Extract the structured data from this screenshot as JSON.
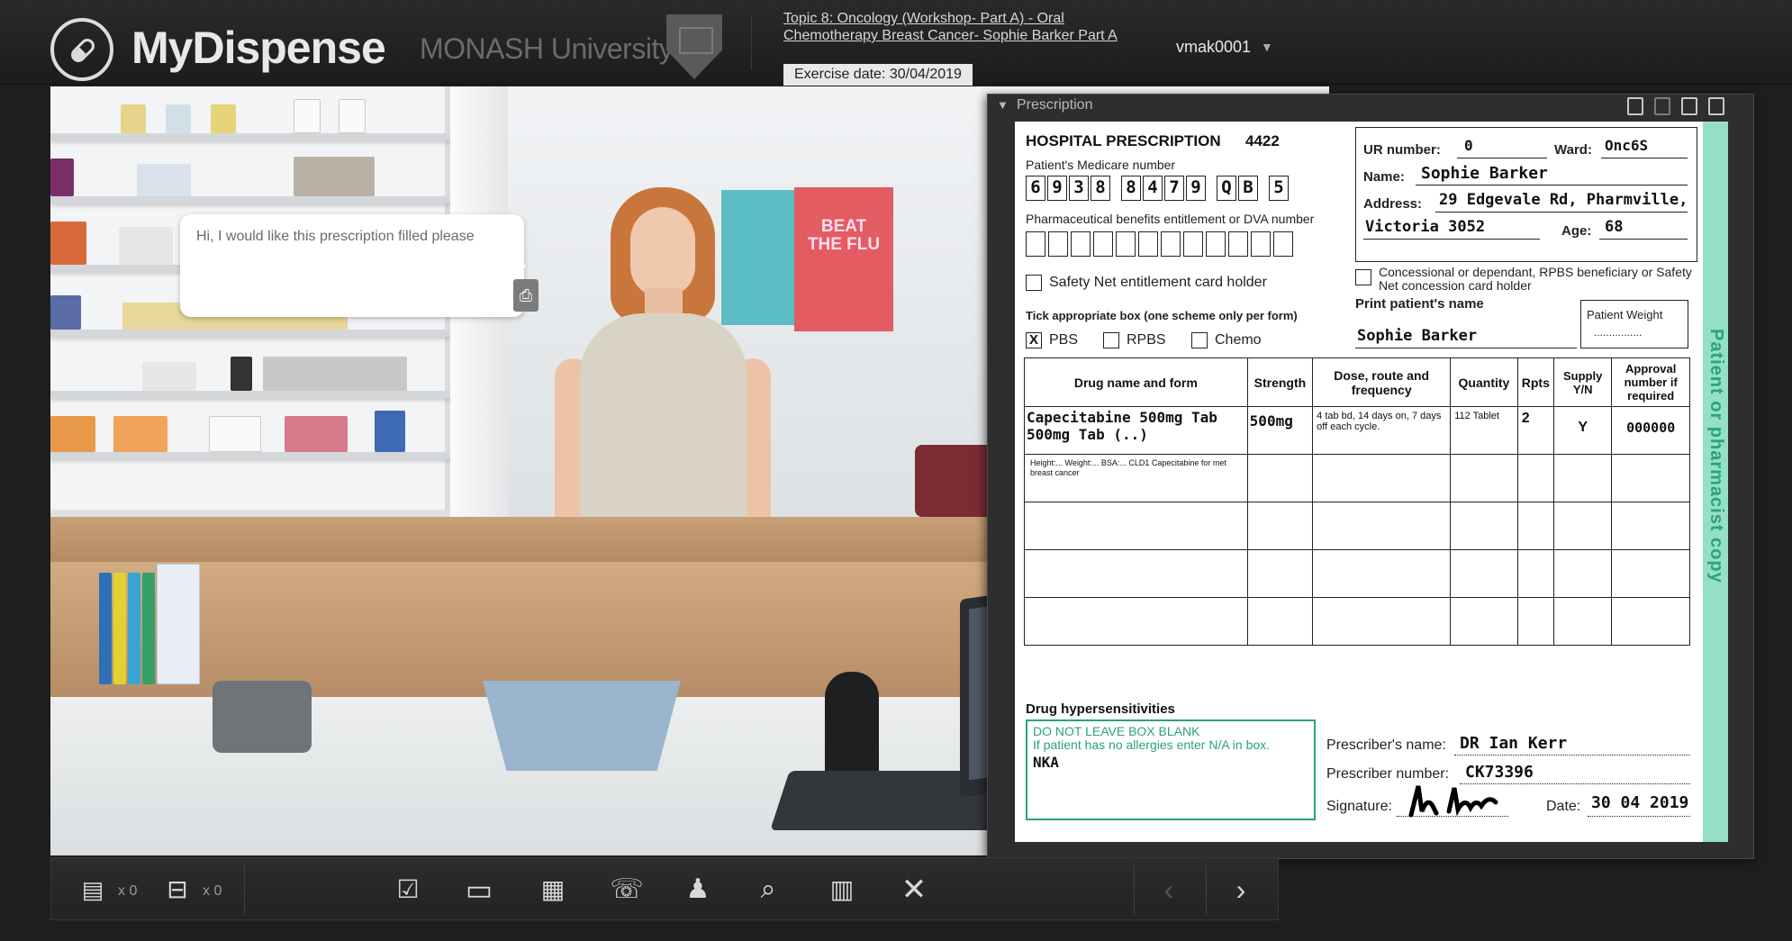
{
  "header": {
    "app_name": "MyDispense",
    "university": "MONASH University",
    "topic_link": "Topic 8: Oncology (Workshop- Part A) - Oral Chemotherapy Breast Cancer- Sophie Barker Part A",
    "exercise_date": "Exercise date: 30/04/2019",
    "username": "vmak0001",
    "user_menu_icon": "chevron-down-icon"
  },
  "scene": {
    "speech_bubble": "Hi, I would like this prescription filled please",
    "poster_text": "BEAT THE FLU"
  },
  "prescription_panel": {
    "title": "Prescription",
    "toolbar_icons": [
      "pointer-icon",
      "copy-icon",
      "paste-icon",
      "export-icon"
    ],
    "form": {
      "heading": "HOSPITAL PRESCRIPTION",
      "number": "4422",
      "medicare_label": "Patient's Medicare number",
      "medicare_groups": [
        [
          "6",
          "9",
          "3",
          "8"
        ],
        [
          "8",
          "4",
          "7",
          "9"
        ],
        [
          "Q",
          "B"
        ],
        [
          "5"
        ]
      ],
      "pbe_label": "Pharmaceutical benefits entitlement or DVA number",
      "safety_net_label": "Safety Net entitlement card holder",
      "scheme_label": "Tick appropriate box (one scheme only per form)",
      "schemes": [
        {
          "label": "PBS",
          "checked": "X"
        },
        {
          "label": "RPBS",
          "checked": ""
        },
        {
          "label": "Chemo",
          "checked": ""
        }
      ],
      "ur_label": "UR number:",
      "ur_value": "0",
      "ward_label": "Ward:",
      "ward_value": "Onc6S",
      "name_label": "Name:",
      "name_value": "Sophie Barker",
      "address_label": "Address:",
      "address_line1": "29 Edgevale Rd, Pharmville,",
      "address_line2": "Victoria 3052",
      "age_label": "Age:",
      "age_value": "68",
      "concession_label": "Concessional or dependant, RPBS beneficiary or Safety Net concession card holder",
      "print_name_label": "Print patient's name",
      "print_name_value": "Sophie Barker",
      "patient_weight_label": "Patient Weight",
      "patient_weight_value": "................",
      "columns": [
        "Drug name and form",
        "Strength",
        "Dose, route and frequency",
        "Quantity",
        "Rpts",
        "Supply Y/N",
        "Approval number if required"
      ],
      "rows": [
        {
          "drug": "Capecitabine 500mg Tab 500mg Tab (..)",
          "strength": "500mg",
          "dose": "4 tab bd, 14 days on, 7 days off each cycle.",
          "quantity": "112 Tablet",
          "rpts": "2",
          "supply": "Y",
          "approval": "000000"
        },
        {
          "drug": "Height:... Weight:... BSA:... CLD1 Capecitabine for met breast cancer",
          "strength": "",
          "dose": "",
          "quantity": "",
          "rpts": "",
          "supply": "",
          "approval": ""
        }
      ],
      "hypersens_title": "Drug hypersensitivities",
      "hypersens_warning": "DO NOT LEAVE BOX BLANK",
      "hypersens_instruction": "If patient has no allergies enter N/A in box.",
      "hypersens_value": "NKA",
      "prescriber_name_label": "Prescriber's name:",
      "prescriber_name_value": "DR Ian Kerr",
      "prescriber_number_label": "Prescriber number:",
      "prescriber_number_value": "CK73396",
      "signature_label": "Signature:",
      "date_label": "Date:",
      "date_value": "30 04 2019",
      "copy_label": "Patient or pharmacist copy"
    }
  },
  "toolbar": {
    "items": [
      {
        "name": "documents-icon",
        "count": "x 0"
      },
      {
        "name": "bottles-icon",
        "count": "x 0"
      }
    ],
    "buttons": [
      "checklist-icon",
      "monitor-icon",
      "dispense-icon",
      "counsel-icon",
      "patient-icon",
      "search-icon",
      "clipboard-icon",
      "close-icon"
    ],
    "nav": [
      "previous-icon",
      "next-icon"
    ]
  }
}
